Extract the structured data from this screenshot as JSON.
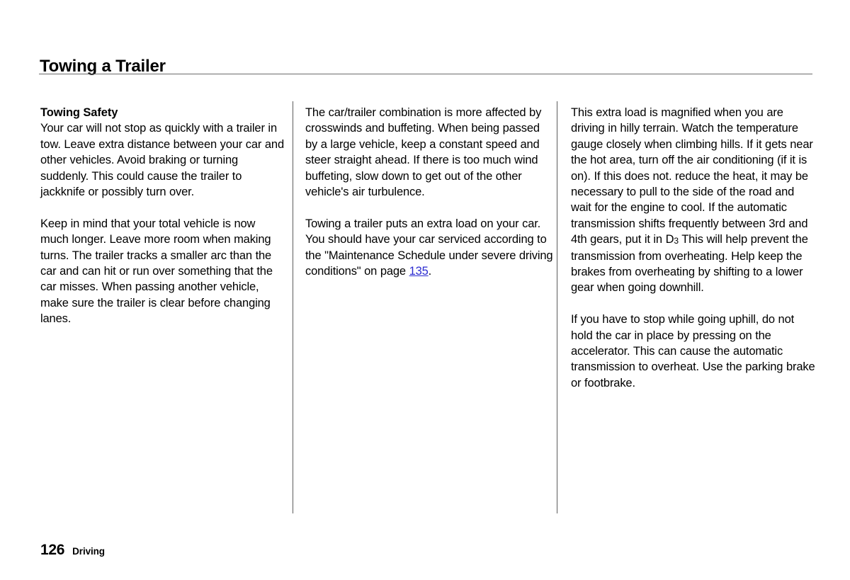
{
  "document": {
    "title": "Towing a Trailer",
    "page_number": "126",
    "section": "Driving"
  },
  "columns": {
    "column_1": {
      "subhead": "Towing Safety",
      "paragraphs": [
        "Your car will not stop as quickly with a trailer in tow. Leave extra distance between your car and other vehicles. Avoid braking or turning suddenly. This could cause the trailer to jackknife or possibly turn over.",
        "Keep in mind that your total vehicle is now much longer. Leave more room when making turns. The trailer tracks a smaller arc than the car and can hit or run over something that the car misses. When passing another vehicle, make sure the trailer is clear before changing lanes."
      ]
    },
    "column_2": {
      "paragraphs": [
        "The car/trailer combination is more affected by crosswinds and buffeting. When being passed by a large vehicle, keep a constant speed and steer straight ahead. If there is too much wind buffeting, slow down to get out of the other vehicle's air turbulence."
      ],
      "service_paragraph": {
        "text_before_link": "Towing a trailer puts an extra load on your car. You should have your car serviced according to the \"Maintenance Schedule under severe driving conditions\" on page ",
        "page_reference_link": "135",
        "text_after_link": "."
      }
    },
    "column_3": {
      "hilly_terrain_paragraph": {
        "text_before_gear": "This extra load is magnified when you are driving in hilly terrain. Watch the temperature gauge closely when climbing hills. If it gets near the hot area, turn off the air conditioning (if it is on). If this does not. reduce the heat, it may be necessary to pull to the side of the road and wait for the engine to cool. If the automatic transmission shifts frequently between 3rd and 4th gears, put it in D",
        "gear_subscript": "3",
        "text_after_gear": " This will help prevent the transmission from overheating. Help keep the brakes from overheating by shifting to a lower gear when going downhill."
      },
      "paragraphs": [
        "If you have to stop while going uphill, do not hold the car in place by pressing on the accelerator. This can cause the automatic transmission to overheat. Use the parking brake or footbrake."
      ]
    }
  },
  "colors": {
    "page_background": "#ffffff",
    "body_text": "#000000",
    "link": "#2b2bd0",
    "rule": "#6b6b6b"
  }
}
